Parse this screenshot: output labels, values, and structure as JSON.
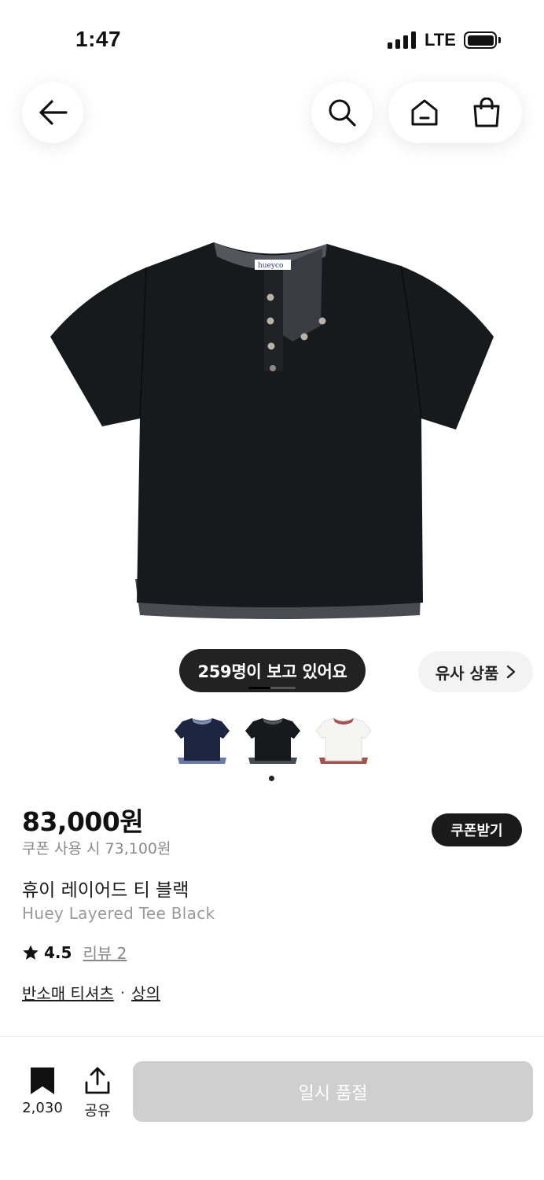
{
  "status_bar": {
    "time": "1:47",
    "network": "LTE"
  },
  "nav": {
    "back_icon": "arrow-left-icon",
    "search_icon": "search-icon",
    "home_icon": "home-icon",
    "cart_icon": "shopping-bag-icon"
  },
  "gallery": {
    "viewers_text": "259명이 보고 있어요",
    "similar_label": "유사 상품",
    "similar_icon": "chevron-right-icon",
    "thumbnails": [
      "navy",
      "black",
      "white"
    ],
    "selected_thumbnail": 1,
    "brand_tag": "hueyco"
  },
  "product": {
    "price": "83,000원",
    "coupon_price": "쿠폰 사용 시 73,100원",
    "coupon_button": "쿠폰받기",
    "title_ko": "휴이 레이어드 티 블랙",
    "title_en": "Huey Layered Tee Black",
    "rating": "4.5",
    "review_link": "리뷰 2",
    "category_1": "반소매 티셔츠",
    "category_separator": "·",
    "category_2": "상의"
  },
  "bottom_bar": {
    "bookmark_count": "2,030",
    "share_label": "공유",
    "soldout_label": "일시 품절"
  },
  "colors": {
    "dark_pill": "#222222",
    "soldout": "#cfcfcf",
    "muted_text": "#8a8a8a"
  }
}
